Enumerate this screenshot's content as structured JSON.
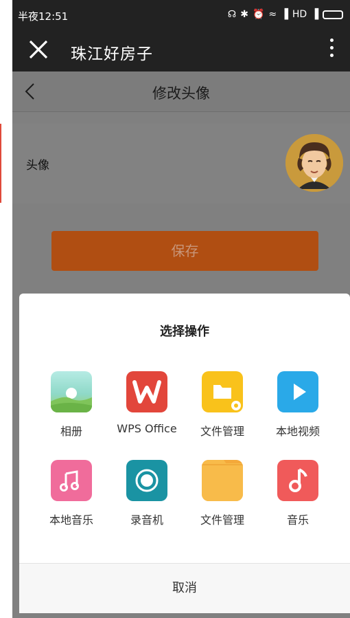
{
  "status_bar": {
    "time": "半夜12:51",
    "network_label": "HD"
  },
  "header": {
    "title": "珠江好房子"
  },
  "page": {
    "title": "修改头像",
    "avatar_label": "头像",
    "save_label": "保存"
  },
  "sheet": {
    "title": "选择操作",
    "apps": [
      {
        "label": "相册",
        "icon": "gallery-icon",
        "color": "#8ed6b6"
      },
      {
        "label": "WPS Office",
        "icon": "wps-office-icon",
        "color": "#e2463b"
      },
      {
        "label": "文件管理",
        "icon": "folder-icon",
        "color": "#f9c21b"
      },
      {
        "label": "本地视频",
        "icon": "video-play-icon",
        "color": "#2aa9e8"
      },
      {
        "label": "本地音乐",
        "icon": "music-note-icon",
        "color": "#f06c9b"
      },
      {
        "label": "录音机",
        "icon": "recorder-icon",
        "color": "#1a93a3"
      },
      {
        "label": "文件管理",
        "icon": "folder-icon",
        "color": "#f8bb4a"
      },
      {
        "label": "音乐",
        "icon": "music-icon",
        "color": "#f05a5a"
      }
    ],
    "cancel_label": "取消"
  }
}
